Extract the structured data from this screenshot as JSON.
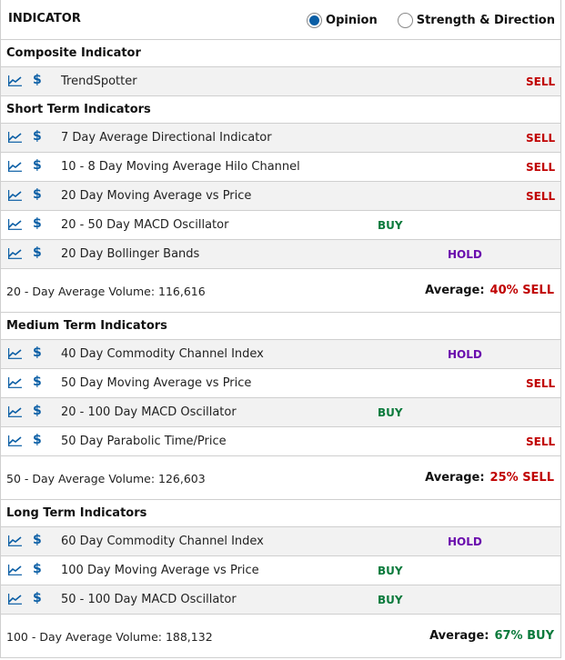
{
  "header": {
    "title": "INDICATOR",
    "radio_options": [
      {
        "label": "Opinion",
        "selected": true
      },
      {
        "label": "Strength & Direction",
        "selected": false
      }
    ]
  },
  "colors": {
    "buy": "#0b7a3c",
    "hold": "#6a0dad",
    "sell": "#c00000",
    "accent": "#0a5ea5"
  },
  "sections": [
    {
      "title": "Composite Indicator",
      "rows": [
        {
          "name": "TrendSpotter",
          "signal": "SELL"
        }
      ]
    },
    {
      "title": "Short Term Indicators",
      "rows": [
        {
          "name": "7 Day Average Directional Indicator",
          "signal": "SELL"
        },
        {
          "name": "10 - 8 Day Moving Average Hilo Channel",
          "signal": "SELL"
        },
        {
          "name": "20 Day Moving Average vs Price",
          "signal": "SELL"
        },
        {
          "name": "20 - 50 Day MACD Oscillator",
          "signal": "BUY"
        },
        {
          "name": "20 Day Bollinger Bands",
          "signal": "HOLD"
        }
      ],
      "summary": {
        "volume_text": "20 - Day Average Volume: 116,616",
        "average_label": "Average:",
        "average_value": "40% SELL",
        "average_signal": "SELL"
      }
    },
    {
      "title": "Medium Term Indicators",
      "rows": [
        {
          "name": "40 Day Commodity Channel Index",
          "signal": "HOLD"
        },
        {
          "name": "50 Day Moving Average vs Price",
          "signal": "SELL"
        },
        {
          "name": "20 - 100 Day MACD Oscillator",
          "signal": "BUY"
        },
        {
          "name": "50 Day Parabolic Time/Price",
          "signal": "SELL"
        }
      ],
      "summary": {
        "volume_text": "50 - Day Average Volume: 126,603",
        "average_label": "Average:",
        "average_value": "25% SELL",
        "average_signal": "SELL"
      }
    },
    {
      "title": "Long Term Indicators",
      "rows": [
        {
          "name": "60 Day Commodity Channel Index",
          "signal": "HOLD"
        },
        {
          "name": "100 Day Moving Average vs Price",
          "signal": "BUY"
        },
        {
          "name": "50 - 100 Day MACD Oscillator",
          "signal": "BUY"
        }
      ],
      "summary": {
        "volume_text": "100 - Day Average Volume: 188,132",
        "average_label": "Average:",
        "average_value": "67% BUY",
        "average_signal": "BUY"
      }
    }
  ]
}
